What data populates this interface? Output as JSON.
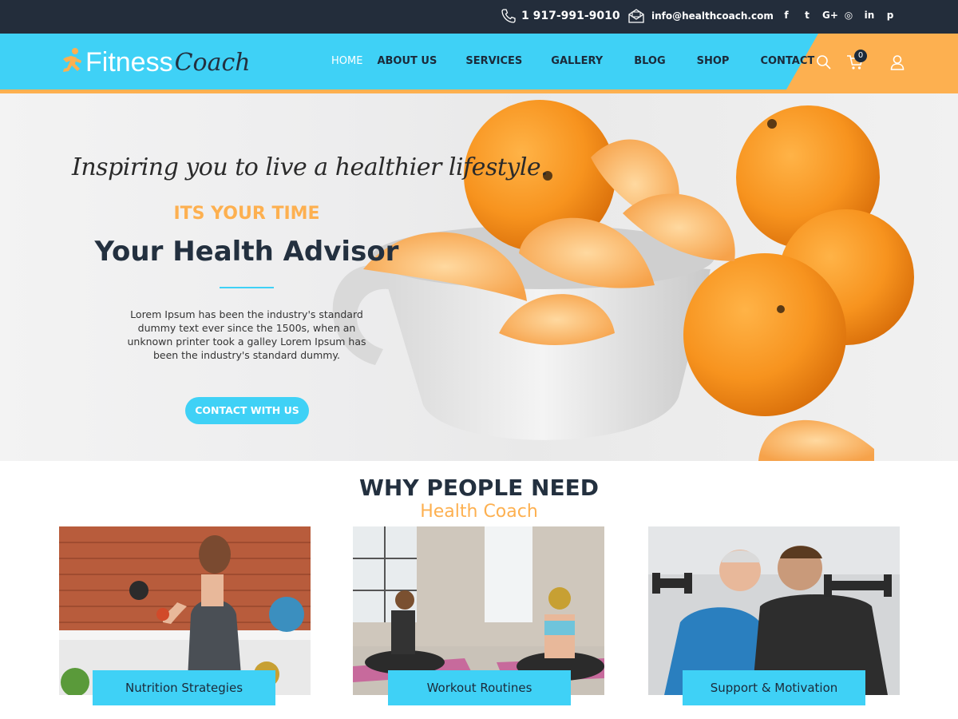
{
  "topbar": {
    "phone": "1 917-991-9010",
    "email": "info@healthcoach.com",
    "socials": [
      "facebook-icon",
      "twitter-icon",
      "google-plus-icon",
      "instagram-icon",
      "linkedin-icon",
      "pinterest-icon"
    ],
    "social_glyphs": [
      "f",
      "t",
      "G+",
      "◎",
      "in",
      "p"
    ]
  },
  "logo": {
    "part1": "Fitness",
    "part2": "Coach"
  },
  "nav": {
    "items": [
      {
        "label": "HOME",
        "active": true
      },
      {
        "label": "ABOUT US",
        "active": false
      },
      {
        "label": "SERVICES",
        "active": false
      },
      {
        "label": "GALLERY",
        "active": false
      },
      {
        "label": "BLOG",
        "active": false
      },
      {
        "label": "SHOP",
        "active": false
      },
      {
        "label": "CONTACT",
        "active": false
      }
    ]
  },
  "header_icons": {
    "cart_count": "0"
  },
  "hero": {
    "script": "Inspiring you to live a healthier lifestyle.",
    "tag": "ITS YOUR TIME",
    "title": "Your Health Advisor",
    "description": "Lorem Ipsum has been the industry's standard dummy text ever since the 1500s, when an unknown printer took a galley Lorem Ipsum has been the industry's standard dummy.",
    "button": "CONTACT WITH US"
  },
  "section": {
    "title": "WHY PEOPLE NEED",
    "subtitle": "Health Coach"
  },
  "cards": [
    {
      "label": "Nutrition Strategies"
    },
    {
      "label": "Workout Routines"
    },
    {
      "label": "Support & Motivation"
    }
  ],
  "colors": {
    "primary": "#3fd1f6",
    "accent": "#fdb050",
    "dark": "#23303f"
  }
}
